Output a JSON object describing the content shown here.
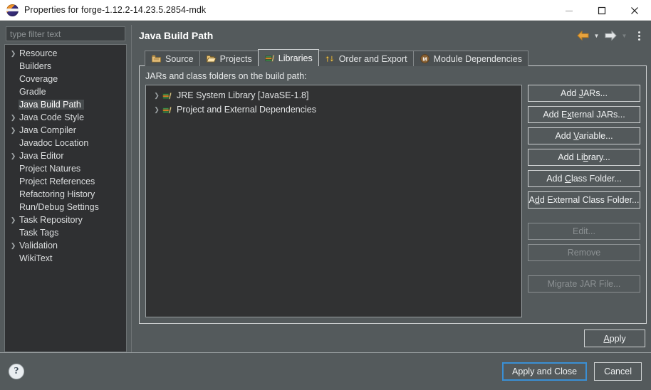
{
  "window": {
    "title": "Properties for forge-1.12.2-14.23.5.2854-mdk",
    "logo_icon": "eclipse-logo-icon",
    "minimize_label": "—",
    "maximize_label": "□",
    "close_label": "✕"
  },
  "sidebar": {
    "filter_placeholder": "type filter text",
    "filter_value": "",
    "items": [
      {
        "label": "Resource",
        "expandable": true,
        "selected": false
      },
      {
        "label": "Builders",
        "expandable": false,
        "selected": false
      },
      {
        "label": "Coverage",
        "expandable": false,
        "selected": false
      },
      {
        "label": "Gradle",
        "expandable": false,
        "selected": false
      },
      {
        "label": "Java Build Path",
        "expandable": false,
        "selected": true
      },
      {
        "label": "Java Code Style",
        "expandable": true,
        "selected": false
      },
      {
        "label": "Java Compiler",
        "expandable": true,
        "selected": false
      },
      {
        "label": "Javadoc Location",
        "expandable": false,
        "selected": false
      },
      {
        "label": "Java Editor",
        "expandable": true,
        "selected": false
      },
      {
        "label": "Project Natures",
        "expandable": false,
        "selected": false
      },
      {
        "label": "Project References",
        "expandable": false,
        "selected": false
      },
      {
        "label": "Refactoring History",
        "expandable": false,
        "selected": false
      },
      {
        "label": "Run/Debug Settings",
        "expandable": false,
        "selected": false
      },
      {
        "label": "Task Repository",
        "expandable": true,
        "selected": false
      },
      {
        "label": "Task Tags",
        "expandable": false,
        "selected": false
      },
      {
        "label": "Validation",
        "expandable": true,
        "selected": false
      },
      {
        "label": "WikiText",
        "expandable": false,
        "selected": false
      }
    ]
  },
  "page": {
    "title": "Java Build Path",
    "nav": {
      "back_icon": "back-arrow-icon",
      "back_dropdown_icon": "chevron-down-icon",
      "forward_icon": "forward-arrow-icon",
      "forward_dropdown_icon": "chevron-down-icon",
      "menu_icon": "kebab-menu-icon"
    },
    "tabs": [
      {
        "label": "Source",
        "icon": "source-folder-icon",
        "active": false
      },
      {
        "label": "Projects",
        "icon": "open-folder-icon",
        "active": false
      },
      {
        "label": "Libraries",
        "icon": "books-icon",
        "active": true
      },
      {
        "label": "Order and Export",
        "icon": "order-arrows-icon",
        "active": false
      },
      {
        "label": "Module Dependencies",
        "icon": "module-m-icon",
        "active": false
      }
    ],
    "panel_label": "JARs and class folders on the build path:",
    "entries": [
      {
        "label": "JRE System Library [JavaSE-1.8]",
        "icon": "library-books-icon",
        "expandable": true
      },
      {
        "label": "Project and External Dependencies",
        "icon": "library-books-icon",
        "expandable": true
      }
    ],
    "buttons": [
      {
        "label": "Add JARs...",
        "mnemonic": "J",
        "enabled": true,
        "gap": false
      },
      {
        "label": "Add External JARs...",
        "mnemonic": "x",
        "enabled": true,
        "gap": false
      },
      {
        "label": "Add Variable...",
        "mnemonic": "V",
        "enabled": true,
        "gap": false
      },
      {
        "label": "Add Library...",
        "mnemonic": "b",
        "enabled": true,
        "gap": false
      },
      {
        "label": "Add Class Folder...",
        "mnemonic": "C",
        "enabled": true,
        "gap": false
      },
      {
        "label": "Add External Class Folder...",
        "mnemonic": "d",
        "enabled": true,
        "gap": false
      },
      {
        "label": "Edit...",
        "mnemonic": "",
        "enabled": false,
        "gap": true
      },
      {
        "label": "Remove",
        "mnemonic": "",
        "enabled": false,
        "gap": false
      },
      {
        "label": "Migrate JAR File...",
        "mnemonic": "",
        "enabled": false,
        "gap": true
      }
    ],
    "apply_label": "Apply",
    "apply_mnemonic": "A"
  },
  "footer": {
    "help_icon": "help-question-icon",
    "help_label": "?",
    "apply_and_close_label": "Apply and Close",
    "cancel_label": "Cancel"
  },
  "colors": {
    "dialog_bg": "#545a5c",
    "tree_bg": "#2f3032",
    "list_bg": "#313233",
    "titlebar_bg": "#ffffff",
    "focus_border": "#3a8fd4",
    "text": "#e4e6e7",
    "disabled_text": "#8b9092",
    "back_arrow": "#e8a33d"
  }
}
